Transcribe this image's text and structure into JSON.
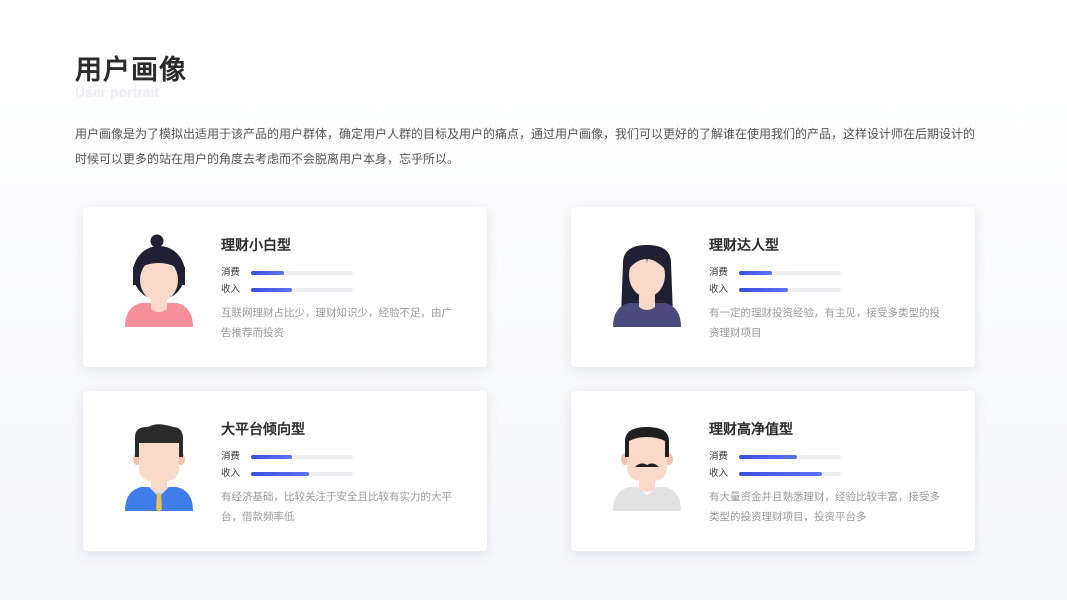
{
  "header": {
    "title": "用户画像",
    "subtitle": "User portrait",
    "description": "用户画像是为了模拟出适用于该产品的用户群体，确定用户人群的目标及用户的痛点，通过用户画像，我们可以更好的了解谁在使用我们的产品，这样设计师在后期设计的时候可以更多的站在用户的角度去考虑而不会脱离用户本身，忘乎所以。"
  },
  "colors": {
    "accent": "#3c4fe0",
    "track": "#eceef2"
  },
  "metric_labels": {
    "consume": "消费",
    "income": "收入"
  },
  "personas": [
    {
      "name": "理财小白型",
      "avatar_icon": "female-bun-hair-pink-shirt-avatar",
      "consume": 0.32,
      "income": 0.4,
      "description": "互联网理财占比少，理财知识少，经验不足，由广告推荐而投资"
    },
    {
      "name": "理财达人型",
      "avatar_icon": "female-long-hair-purple-shirt-avatar",
      "consume": 0.32,
      "income": 0.48,
      "description": "有一定的理财投资经验，有主见，接受多类型的投资理财项目"
    },
    {
      "name": "大平台倾向型",
      "avatar_icon": "male-blue-shirt-tie-avatar",
      "consume": 0.4,
      "income": 0.57,
      "description": "有经济基础，比较关注于安全且比较有实力的大平台，借款频率低"
    },
    {
      "name": "理财高净值型",
      "avatar_icon": "male-mustache-grey-shirt-avatar",
      "consume": 0.57,
      "income": 0.81,
      "description": "有大量资金并且熟悉理财，经验比较丰富，接受多类型的投资理财项目，投资平台多"
    }
  ]
}
